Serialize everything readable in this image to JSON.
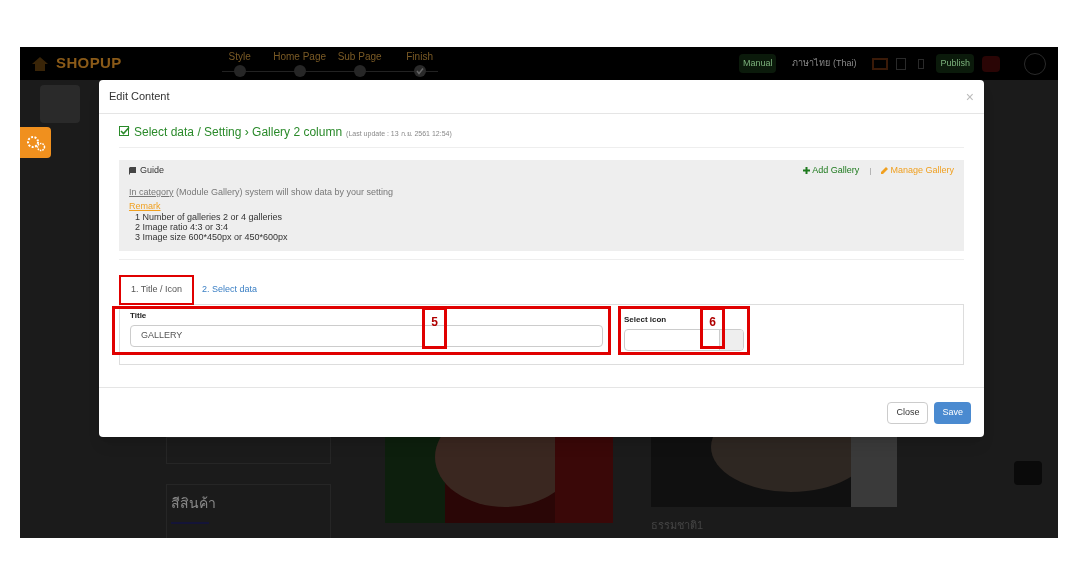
{
  "app_header": {
    "logo": "SHOPUP",
    "steps": [
      {
        "label": "Style",
        "kind": "number"
      },
      {
        "label": "Home Page",
        "kind": "number"
      },
      {
        "label": "Sub Page",
        "kind": "number"
      },
      {
        "label": "Finish",
        "kind": "check"
      }
    ],
    "manual": "Manual",
    "language": "ภาษาไทย (Thai)",
    "publish": "Publish"
  },
  "back_page": {
    "category_heading": "สีสินค้า",
    "gallery_captions": [
      "ธรรมชาติ1"
    ]
  },
  "modal": {
    "title": "Edit Content",
    "close": "×",
    "heading": "Select data / Setting › Gallery 2 column",
    "last_update": "(Last update : 13 ก.ย. 2561 12:54)",
    "guide": {
      "title": "Guide",
      "link": "In category",
      "text": "(Module Gallery) system will show data by your setting",
      "remark": "Remark",
      "items": [
        "1 Number of galleries 2 or 4 galleries",
        "2 Image ratio 4:3 or 3:4",
        "3 Image size 600*450px or 450*600px"
      ],
      "add": "Add Gallery",
      "separator": "|",
      "manage": "Manage Gallery"
    },
    "tabs": [
      {
        "label": "1. Title / Icon",
        "selected": true
      },
      {
        "label": "2. Select data",
        "selected": false
      }
    ],
    "title_field": {
      "label": "Title",
      "value": "GALLERY",
      "annotation": "5"
    },
    "icon_field": {
      "label": "Select icon",
      "annotation": "6"
    },
    "buttons": [
      {
        "label": "Close",
        "kind": "default"
      },
      {
        "label": "Save",
        "kind": "primary"
      }
    ]
  }
}
